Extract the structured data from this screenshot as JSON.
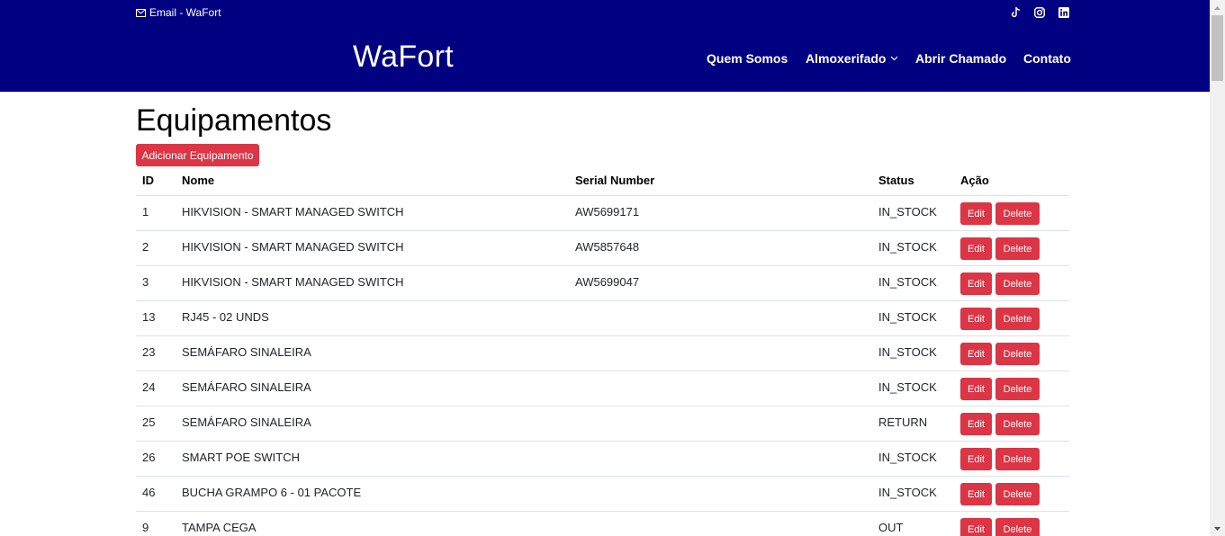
{
  "header": {
    "email_label": "Email - WaFort",
    "brand": "WaFort",
    "social": [
      "tiktok-icon",
      "instagram-icon",
      "linkedin-icon"
    ],
    "nav": {
      "quem_somos": "Quem Somos",
      "almoxerifado": "Almoxerifado",
      "abrir_chamado": "Abrir Chamado",
      "contato": "Contato"
    },
    "background_color": "#000080"
  },
  "main": {
    "title": "Equipamentos",
    "add_button": "Adicionar Equipamento",
    "accent_color": "#dc3545",
    "table": {
      "columns": {
        "id": "ID",
        "nome": "Nome",
        "serial": "Serial Number",
        "status": "Status",
        "acao": "Ação"
      },
      "edit_label": "Edit",
      "delete_label": "Delete",
      "rows": [
        {
          "id": "1",
          "nome": "HIKVISION - SMART MANAGED SWITCH",
          "serial": "AW5699171",
          "status": "IN_STOCK"
        },
        {
          "id": "2",
          "nome": "HIKVISION - SMART MANAGED SWITCH",
          "serial": "AW5857648",
          "status": "IN_STOCK"
        },
        {
          "id": "3",
          "nome": "HIKVISION - SMART MANAGED SWITCH",
          "serial": "AW5699047",
          "status": "IN_STOCK"
        },
        {
          "id": "13",
          "nome": "RJ45 - 02 UNDS",
          "serial": "",
          "status": "IN_STOCK"
        },
        {
          "id": "23",
          "nome": "SEMÁFARO SINALEIRA",
          "serial": "",
          "status": "IN_STOCK"
        },
        {
          "id": "24",
          "nome": "SEMÁFARO SINALEIRA",
          "serial": "",
          "status": "IN_STOCK"
        },
        {
          "id": "25",
          "nome": "SEMÁFARO SINALEIRA",
          "serial": "",
          "status": "RETURN"
        },
        {
          "id": "26",
          "nome": "SMART POE SWITCH",
          "serial": "",
          "status": "IN_STOCK"
        },
        {
          "id": "46",
          "nome": "BUCHA GRAMPO 6 - 01 PACOTE",
          "serial": "",
          "status": "IN_STOCK"
        },
        {
          "id": "9",
          "nome": "TAMPA CEGA",
          "serial": "",
          "status": "OUT"
        }
      ]
    }
  }
}
